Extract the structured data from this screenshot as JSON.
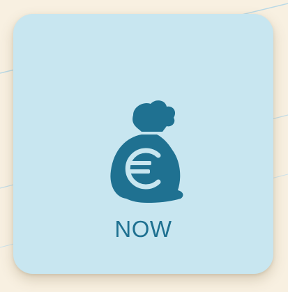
{
  "tile": {
    "label": "NOW",
    "icon": "euro-money-bag-icon",
    "colors": {
      "page_background": "#f8f0e1",
      "card_background": "#c8e6f0",
      "icon": "#1f7191",
      "label": "#1f7191"
    }
  }
}
